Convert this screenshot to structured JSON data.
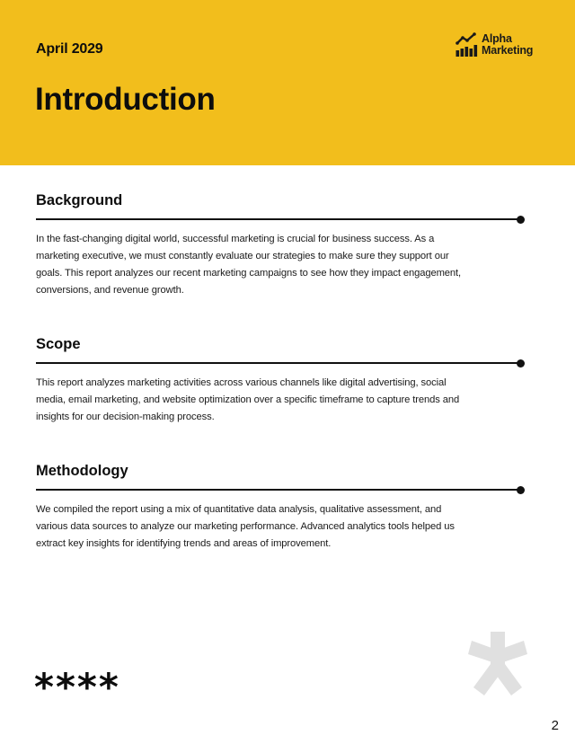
{
  "header": {
    "date": "April 2029",
    "title": "Introduction",
    "background_color": "#F2BE1C",
    "logo": {
      "icon": "chart-growth-icon",
      "line1": "Alpha",
      "line2": "Marketing"
    }
  },
  "sections": [
    {
      "heading": "Background",
      "body": "In the fast-changing digital world, successful marketing is crucial for business success. As a marketing executive, we must constantly evaluate our strategies to make sure they support our goals. This report analyzes our recent marketing campaigns to see how they impact engagement, conversions, and revenue growth."
    },
    {
      "heading": "Scope",
      "body": "This report analyzes marketing activities across various channels like digital advertising, social media, email marketing, and website optimization over a specific timeframe to capture trends and insights for our decision-making process."
    },
    {
      "heading": "Methodology",
      "body": "We compiled the report using a mix of quantitative data analysis, qualitative assessment, and various data sources to analyze our marketing performance. Advanced analytics tools helped us extract key insights for identifying trends and areas of improvement."
    }
  ],
  "decoration": {
    "stars": "****",
    "large_asterisk_icon": "asterisk-icon",
    "large_asterisk_color": "#E0E0E0"
  },
  "footer": {
    "page_number": "2"
  }
}
